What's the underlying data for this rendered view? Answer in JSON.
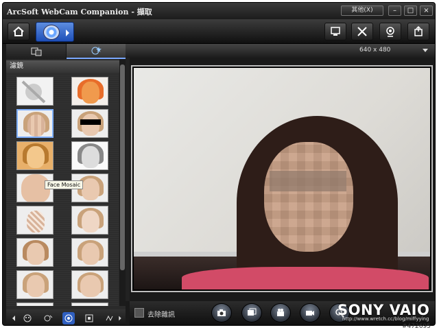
{
  "window": {
    "title": "ArcSoft WebCam Companion - 擷取",
    "others_label": "其他(X)",
    "minimize": "–",
    "maximize": "□",
    "close": "×"
  },
  "toolbar": {
    "home_icon": "home-icon",
    "capture_icon": "webcam-lens-icon",
    "right_buttons": [
      "monitor-icon",
      "tools-icon",
      "webcam-icon",
      "export-icon"
    ]
  },
  "left_panel": {
    "tabs": [
      "frames-tab",
      "effects-tab"
    ],
    "filter_header": "濾鏡",
    "tooltip": "Face Mosaic",
    "bottom_icons": [
      "prev-icon",
      "face-icon",
      "face-effect-icon",
      "filter-icon",
      "frame-icon",
      "fun-icon",
      "next-icon"
    ]
  },
  "preview": {
    "resolution": "640 x 480"
  },
  "controls": {
    "denoise_label": "去除雜訊",
    "buttons": [
      "camera-icon",
      "slideshow-icon",
      "record-icon",
      "video-icon",
      "zoom-icon"
    ]
  },
  "watermark": {
    "brand": "SONY VAIO",
    "url": "http://www.wretch.cc/blog/miffyying",
    "id": "#472695"
  },
  "colors": {
    "accent": "#2f5fc0",
    "shirt": "#d24b67"
  }
}
